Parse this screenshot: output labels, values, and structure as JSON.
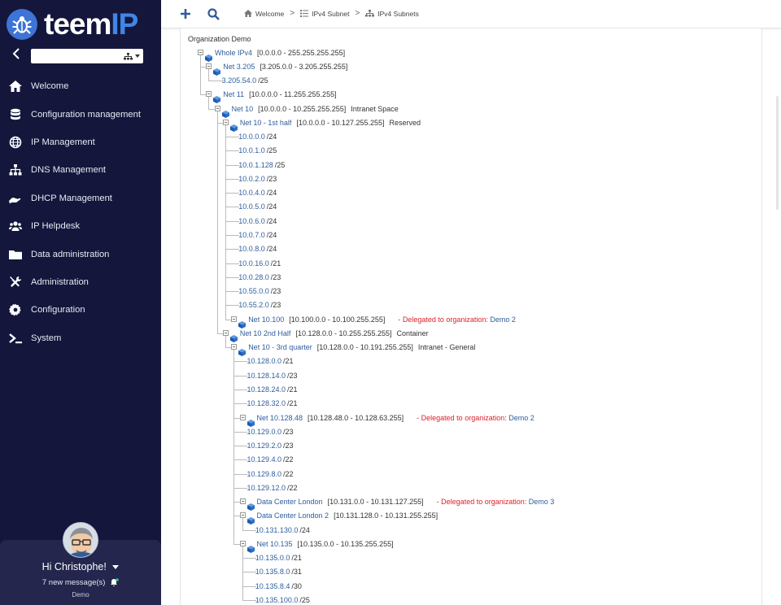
{
  "app": {
    "logo_text_a": "teem",
    "logo_text_b": "IP"
  },
  "sidebar": {
    "items": [
      {
        "label": "Welcome",
        "icon": "home-icon"
      },
      {
        "label": "Configuration management",
        "icon": "database-icon"
      },
      {
        "label": "IP Management",
        "icon": "globe-icon"
      },
      {
        "label": "DNS Management",
        "icon": "sitemap-icon"
      },
      {
        "label": "DHCP Management",
        "icon": "hand-icon"
      },
      {
        "label": "IP Helpdesk",
        "icon": "users-icon"
      },
      {
        "label": "Data administration",
        "icon": "folder-icon"
      },
      {
        "label": "Administration",
        "icon": "tools-icon"
      },
      {
        "label": "Configuration",
        "icon": "gear-icon"
      },
      {
        "label": "System",
        "icon": "terminal-icon"
      }
    ]
  },
  "user": {
    "greeting": "Hi Christophe!",
    "messages": "7 new message(s)",
    "org": "Demo"
  },
  "breadcrumb": [
    "Welcome",
    "IPv4 Subnet",
    "IPv4 Subnets"
  ],
  "tree": {
    "title": "Organization Demo",
    "nodes": [
      {
        "d": 0,
        "type": "branch",
        "name": "Whole IPv4",
        "range": "[0.0.0.0 - 255.255.255.255]"
      },
      {
        "d": 1,
        "type": "branch",
        "name": "Net 3.205",
        "range": "[3.205.0.0 - 3.205.255.255]"
      },
      {
        "d": 2,
        "type": "leaf",
        "name": "3.205.54.0",
        "mask": "/25"
      },
      {
        "d": 1,
        "type": "branch",
        "name": "Net 11",
        "range": "[10.0.0.0 - 11.255.255.255]"
      },
      {
        "d": 2,
        "type": "branch",
        "name": "Net 10",
        "range": "[10.0.0.0 - 10.255.255.255]",
        "desc": "Intranet Space"
      },
      {
        "d": 3,
        "type": "branch",
        "name": "Net 10 - 1st half",
        "range": "[10.0.0.0 - 10.127.255.255]",
        "desc": "Reserved"
      },
      {
        "d": 4,
        "type": "leaf",
        "name": "10.0.0.0",
        "mask": "/24"
      },
      {
        "d": 4,
        "type": "leaf",
        "name": "10.0.1.0",
        "mask": "/25"
      },
      {
        "d": 4,
        "type": "leaf",
        "name": "10.0.1.128",
        "mask": "/25"
      },
      {
        "d": 4,
        "type": "leaf",
        "name": "10.0.2.0",
        "mask": "/23"
      },
      {
        "d": 4,
        "type": "leaf",
        "name": "10.0.4.0",
        "mask": "/24"
      },
      {
        "d": 4,
        "type": "leaf",
        "name": "10.0.5.0",
        "mask": "/24"
      },
      {
        "d": 4,
        "type": "leaf",
        "name": "10.0.6.0",
        "mask": "/24"
      },
      {
        "d": 4,
        "type": "leaf",
        "name": "10.0.7.0",
        "mask": "/24"
      },
      {
        "d": 4,
        "type": "leaf",
        "name": "10.0.8.0",
        "mask": "/24"
      },
      {
        "d": 4,
        "type": "leaf",
        "name": "10.0.16.0",
        "mask": "/21"
      },
      {
        "d": 4,
        "type": "leaf",
        "name": "10.0.28.0",
        "mask": "/23"
      },
      {
        "d": 4,
        "type": "leaf",
        "name": "10.55.0.0",
        "mask": "/23"
      },
      {
        "d": 4,
        "type": "leaf",
        "name": "10.55.2.0",
        "mask": "/23"
      },
      {
        "d": 4,
        "type": "branch",
        "name": "Net 10.100",
        "range": "[10.100.0.0 - 10.100.255.255]",
        "del": "- Delegated to organization: ",
        "delorg": "Demo 2"
      },
      {
        "d": 3,
        "type": "branch",
        "name": "Net 10 2nd Half",
        "range": "[10.128.0.0 - 10.255.255.255]",
        "desc": "Container"
      },
      {
        "d": 4,
        "type": "branch",
        "name": "Net 10 - 3rd quarter",
        "range": "[10.128.0.0 - 10.191.255.255]",
        "desc": "Intranet - General"
      },
      {
        "d": 5,
        "type": "leaf",
        "name": "10.128.0.0",
        "mask": "/21"
      },
      {
        "d": 5,
        "type": "leaf",
        "name": "10.128.14.0",
        "mask": "/23"
      },
      {
        "d": 5,
        "type": "leaf",
        "name": "10.128.24.0",
        "mask": "/21"
      },
      {
        "d": 5,
        "type": "leaf",
        "name": "10.128.32.0",
        "mask": "/21"
      },
      {
        "d": 5,
        "type": "branch",
        "name": "Net 10.128.48",
        "range": "[10.128.48.0 - 10.128.63.255]",
        "del": "- Delegated to organization: ",
        "delorg": "Demo 2"
      },
      {
        "d": 5,
        "type": "leaf",
        "name": "10.129.0.0",
        "mask": "/23"
      },
      {
        "d": 5,
        "type": "leaf",
        "name": "10.129.2.0",
        "mask": "/23"
      },
      {
        "d": 5,
        "type": "leaf",
        "name": "10.129.4.0",
        "mask": "/22"
      },
      {
        "d": 5,
        "type": "leaf",
        "name": "10.129.8.0",
        "mask": "/22"
      },
      {
        "d": 5,
        "type": "leaf",
        "name": "10.129.12.0",
        "mask": "/22"
      },
      {
        "d": 5,
        "type": "branch",
        "name": "Data Center London",
        "range": "[10.131.0.0 - 10.131.127.255]",
        "del": "- Delegated to organization: ",
        "delorg": "Demo 3"
      },
      {
        "d": 5,
        "type": "branch",
        "name": "Data Center London 2",
        "range": "[10.131.128.0 - 10.131.255.255]"
      },
      {
        "d": 6,
        "type": "leaf",
        "name": "10.131.130.0",
        "mask": "/24"
      },
      {
        "d": 5,
        "type": "branch",
        "name": "Net 10.135",
        "range": "[10.135.0.0 - 10.135.255.255]"
      },
      {
        "d": 6,
        "type": "leaf",
        "name": "10.135.0.0",
        "mask": "/21"
      },
      {
        "d": 6,
        "type": "leaf",
        "name": "10.135.8.0",
        "mask": "/31"
      },
      {
        "d": 6,
        "type": "leaf",
        "name": "10.135.8.4",
        "mask": "/30"
      },
      {
        "d": 6,
        "type": "leaf",
        "name": "10.135.100.0",
        "mask": "/25"
      }
    ]
  },
  "colors": {
    "sidebar": "#14163c",
    "accent": "#3e74d6",
    "link": "#2f5d9e",
    "delegated": "#d9232a"
  }
}
